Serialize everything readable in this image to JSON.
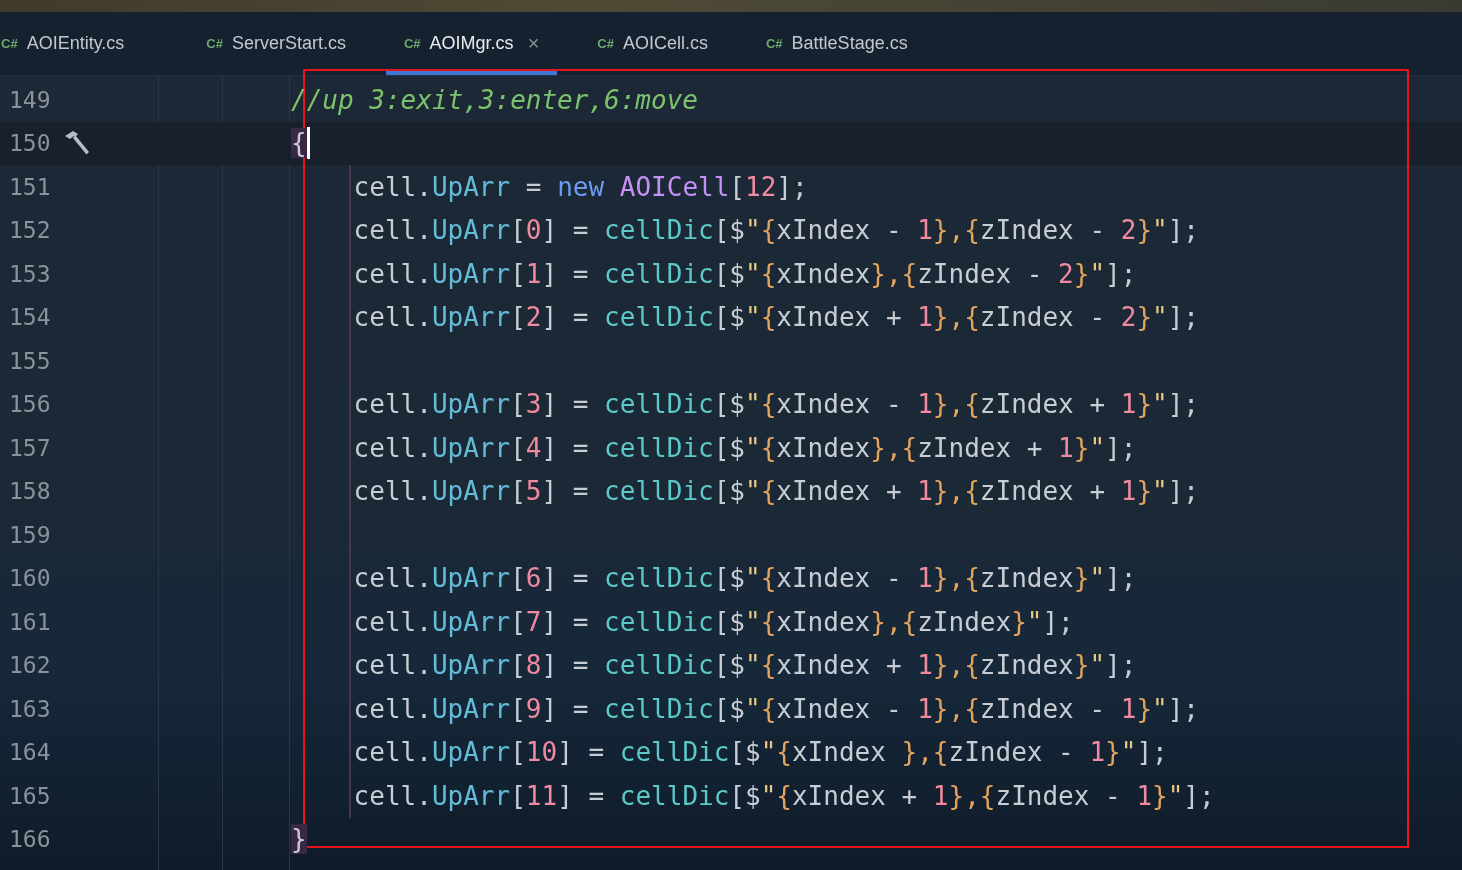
{
  "tabs": [
    {
      "icon_text": "C#",
      "label": "AOIEntity.cs",
      "selected": false
    },
    {
      "icon_text": "C#",
      "label": "ServerStart.cs",
      "selected": false
    },
    {
      "icon_text": "C#",
      "label": "AOIMgr.cs",
      "selected": true,
      "close": "×"
    },
    {
      "icon_text": "C#",
      "label": "AOICell.cs",
      "selected": false
    },
    {
      "icon_text": "C#",
      "label": "BattleStage.cs",
      "selected": false
    }
  ],
  "lines": [
    {
      "number": "149",
      "current": false,
      "build_marker": false,
      "caret": false,
      "tokens": [
        {
          "kind": "comment",
          "text": "//up 3:exit,3:enter,6:move"
        }
      ]
    },
    {
      "number": "150",
      "current": true,
      "build_marker": true,
      "caret": true,
      "tokens": [
        {
          "kind": "match",
          "text": "{"
        }
      ],
      "children": [
        {
          "number": "151",
          "current": false,
          "build_marker": false,
          "caret": false,
          "tokens": [
            {
              "kind": "plain",
              "text": "cell."
            },
            {
              "kind": "field",
              "text": "UpArr"
            },
            {
              "kind": "plain",
              "text": " = "
            },
            {
              "kind": "keyword",
              "text": "new"
            },
            {
              "kind": "type",
              "text": " AOICell"
            },
            {
              "kind": "plain",
              "text": "["
            },
            {
              "kind": "number",
              "text": "12"
            },
            {
              "kind": "plain",
              "text": "];"
            }
          ]
        },
        {
          "number": "152",
          "current": false,
          "build_marker": false,
          "caret": false,
          "tokens": [
            {
              "kind": "plain",
              "text": "cell."
            },
            {
              "kind": "field",
              "text": "UpArr"
            },
            {
              "kind": "plain",
              "text": "["
            },
            {
              "kind": "number",
              "text": "0"
            },
            {
              "kind": "plain",
              "text": "] = "
            },
            {
              "kind": "method",
              "text": "cellDic"
            },
            {
              "kind": "plain",
              "text": "[$"
            },
            {
              "kind": "string",
              "text": "\""
            },
            {
              "kind": "brace",
              "text": "{"
            },
            {
              "kind": "plain",
              "text": "xIndex - "
            },
            {
              "kind": "number",
              "text": "1"
            },
            {
              "kind": "brace",
              "text": "},{"
            },
            {
              "kind": "plain",
              "text": "zIndex - "
            },
            {
              "kind": "number",
              "text": "2"
            },
            {
              "kind": "brace",
              "text": "}"
            },
            {
              "kind": "string",
              "text": "\""
            },
            {
              "kind": "plain",
              "text": "];"
            }
          ]
        },
        {
          "number": "153",
          "current": false,
          "build_marker": false,
          "caret": false,
          "tokens": [
            {
              "kind": "plain",
              "text": "cell."
            },
            {
              "kind": "field",
              "text": "UpArr"
            },
            {
              "kind": "plain",
              "text": "["
            },
            {
              "kind": "number",
              "text": "1"
            },
            {
              "kind": "plain",
              "text": "] = "
            },
            {
              "kind": "method",
              "text": "cellDic"
            },
            {
              "kind": "plain",
              "text": "[$"
            },
            {
              "kind": "string",
              "text": "\""
            },
            {
              "kind": "brace",
              "text": "{"
            },
            {
              "kind": "plain",
              "text": "xIndex"
            },
            {
              "kind": "brace",
              "text": "},{"
            },
            {
              "kind": "plain",
              "text": "zIndex - "
            },
            {
              "kind": "number",
              "text": "2"
            },
            {
              "kind": "brace",
              "text": "}"
            },
            {
              "kind": "string",
              "text": "\""
            },
            {
              "kind": "plain",
              "text": "];"
            }
          ]
        },
        {
          "number": "154",
          "current": false,
          "build_marker": false,
          "caret": false,
          "tokens": [
            {
              "kind": "plain",
              "text": "cell."
            },
            {
              "kind": "field",
              "text": "UpArr"
            },
            {
              "kind": "plain",
              "text": "["
            },
            {
              "kind": "number",
              "text": "2"
            },
            {
              "kind": "plain",
              "text": "] = "
            },
            {
              "kind": "method",
              "text": "cellDic"
            },
            {
              "kind": "plain",
              "text": "[$"
            },
            {
              "kind": "string",
              "text": "\""
            },
            {
              "kind": "brace",
              "text": "{"
            },
            {
              "kind": "plain",
              "text": "xIndex + "
            },
            {
              "kind": "number",
              "text": "1"
            },
            {
              "kind": "brace",
              "text": "},{"
            },
            {
              "kind": "plain",
              "text": "zIndex - "
            },
            {
              "kind": "number",
              "text": "2"
            },
            {
              "kind": "brace",
              "text": "}"
            },
            {
              "kind": "string",
              "text": "\""
            },
            {
              "kind": "plain",
              "text": "];"
            }
          ]
        },
        {
          "number": "155",
          "current": false,
          "build_marker": false,
          "caret": false
        },
        {
          "number": "156",
          "current": false,
          "build_marker": false,
          "caret": false,
          "tokens": [
            {
              "kind": "plain",
              "text": "cell."
            },
            {
              "kind": "field",
              "text": "UpArr"
            },
            {
              "kind": "plain",
              "text": "["
            },
            {
              "kind": "number",
              "text": "3"
            },
            {
              "kind": "plain",
              "text": "] = "
            },
            {
              "kind": "method",
              "text": "cellDic"
            },
            {
              "kind": "plain",
              "text": "[$"
            },
            {
              "kind": "string",
              "text": "\""
            },
            {
              "kind": "brace",
              "text": "{"
            },
            {
              "kind": "plain",
              "text": "xIndex - "
            },
            {
              "kind": "number",
              "text": "1"
            },
            {
              "kind": "brace",
              "text": "},{"
            },
            {
              "kind": "plain",
              "text": "zIndex + "
            },
            {
              "kind": "number",
              "text": "1"
            },
            {
              "kind": "brace",
              "text": "}"
            },
            {
              "kind": "string",
              "text": "\""
            },
            {
              "kind": "plain",
              "text": "];"
            }
          ]
        },
        {
          "number": "157",
          "current": false,
          "build_marker": false,
          "caret": false,
          "tokens": [
            {
              "kind": "plain",
              "text": "cell."
            },
            {
              "kind": "field",
              "text": "UpArr"
            },
            {
              "kind": "plain",
              "text": "["
            },
            {
              "kind": "number",
              "text": "4"
            },
            {
              "kind": "plain",
              "text": "] = "
            },
            {
              "kind": "method",
              "text": "cellDic"
            },
            {
              "kind": "plain",
              "text": "[$"
            },
            {
              "kind": "string",
              "text": "\""
            },
            {
              "kind": "brace",
              "text": "{"
            },
            {
              "kind": "plain",
              "text": "xIndex"
            },
            {
              "kind": "brace",
              "text": "},{"
            },
            {
              "kind": "plain",
              "text": "zIndex + "
            },
            {
              "kind": "number",
              "text": "1"
            },
            {
              "kind": "brace",
              "text": "}"
            },
            {
              "kind": "string",
              "text": "\""
            },
            {
              "kind": "plain",
              "text": "];"
            }
          ]
        },
        {
          "number": "158",
          "current": false,
          "build_marker": false,
          "caret": false,
          "tokens": [
            {
              "kind": "plain",
              "text": "cell."
            },
            {
              "kind": "field",
              "text": "UpArr"
            },
            {
              "kind": "plain",
              "text": "["
            },
            {
              "kind": "number",
              "text": "5"
            },
            {
              "kind": "plain",
              "text": "] = "
            },
            {
              "kind": "method",
              "text": "cellDic"
            },
            {
              "kind": "plain",
              "text": "[$"
            },
            {
              "kind": "string",
              "text": "\""
            },
            {
              "kind": "brace",
              "text": "{"
            },
            {
              "kind": "plain",
              "text": "xIndex + "
            },
            {
              "kind": "number",
              "text": "1"
            },
            {
              "kind": "brace",
              "text": "},{"
            },
            {
              "kind": "plain",
              "text": "zIndex + "
            },
            {
              "kind": "number",
              "text": "1"
            },
            {
              "kind": "brace",
              "text": "}"
            },
            {
              "kind": "string",
              "text": "\""
            },
            {
              "kind": "plain",
              "text": "];"
            }
          ]
        },
        {
          "number": "159",
          "current": false,
          "build_marker": false,
          "caret": false
        },
        {
          "number": "160",
          "current": false,
          "build_marker": false,
          "caret": false,
          "tokens": [
            {
              "kind": "plain",
              "text": "cell."
            },
            {
              "kind": "field",
              "text": "UpArr"
            },
            {
              "kind": "plain",
              "text": "["
            },
            {
              "kind": "number",
              "text": "6"
            },
            {
              "kind": "plain",
              "text": "] = "
            },
            {
              "kind": "method",
              "text": "cellDic"
            },
            {
              "kind": "plain",
              "text": "[$"
            },
            {
              "kind": "string",
              "text": "\""
            },
            {
              "kind": "brace",
              "text": "{"
            },
            {
              "kind": "plain",
              "text": "xIndex - "
            },
            {
              "kind": "number",
              "text": "1"
            },
            {
              "kind": "brace",
              "text": "},{"
            },
            {
              "kind": "plain",
              "text": "zIndex"
            },
            {
              "kind": "brace",
              "text": "}"
            },
            {
              "kind": "string",
              "text": "\""
            },
            {
              "kind": "plain",
              "text": "];"
            }
          ]
        },
        {
          "number": "161",
          "current": false,
          "build_marker": false,
          "caret": false,
          "tokens": [
            {
              "kind": "plain",
              "text": "cell."
            },
            {
              "kind": "field",
              "text": "UpArr"
            },
            {
              "kind": "plain",
              "text": "["
            },
            {
              "kind": "number",
              "text": "7"
            },
            {
              "kind": "plain",
              "text": "] = "
            },
            {
              "kind": "method",
              "text": "cellDic"
            },
            {
              "kind": "plain",
              "text": "[$"
            },
            {
              "kind": "string",
              "text": "\""
            },
            {
              "kind": "brace",
              "text": "{"
            },
            {
              "kind": "plain",
              "text": "xIndex"
            },
            {
              "kind": "brace",
              "text": "},{"
            },
            {
              "kind": "plain",
              "text": "zIndex"
            },
            {
              "kind": "brace",
              "text": "}"
            },
            {
              "kind": "string",
              "text": "\""
            },
            {
              "kind": "plain",
              "text": "];"
            }
          ]
        },
        {
          "number": "162",
          "current": false,
          "build_marker": false,
          "caret": false,
          "tokens": [
            {
              "kind": "plain",
              "text": "cell."
            },
            {
              "kind": "field",
              "text": "UpArr"
            },
            {
              "kind": "plain",
              "text": "["
            },
            {
              "kind": "number",
              "text": "8"
            },
            {
              "kind": "plain",
              "text": "] = "
            },
            {
              "kind": "method",
              "text": "cellDic"
            },
            {
              "kind": "plain",
              "text": "[$"
            },
            {
              "kind": "string",
              "text": "\""
            },
            {
              "kind": "brace",
              "text": "{"
            },
            {
              "kind": "plain",
              "text": "xIndex + "
            },
            {
              "kind": "number",
              "text": "1"
            },
            {
              "kind": "brace",
              "text": "},{"
            },
            {
              "kind": "plain",
              "text": "zIndex"
            },
            {
              "kind": "brace",
              "text": "}"
            },
            {
              "kind": "string",
              "text": "\""
            },
            {
              "kind": "plain",
              "text": "];"
            }
          ]
        },
        {
          "number": "163",
          "current": false,
          "build_marker": false,
          "caret": false,
          "tokens": [
            {
              "kind": "plain",
              "text": "cell."
            },
            {
              "kind": "field",
              "text": "UpArr"
            },
            {
              "kind": "plain",
              "text": "["
            },
            {
              "kind": "number",
              "text": "9"
            },
            {
              "kind": "plain",
              "text": "] = "
            },
            {
              "kind": "method",
              "text": "cellDic"
            },
            {
              "kind": "plain",
              "text": "[$"
            },
            {
              "kind": "string",
              "text": "\""
            },
            {
              "kind": "brace",
              "text": "{"
            },
            {
              "kind": "plain",
              "text": "xIndex - "
            },
            {
              "kind": "number",
              "text": "1"
            },
            {
              "kind": "brace",
              "text": "},{"
            },
            {
              "kind": "plain",
              "text": "zIndex - "
            },
            {
              "kind": "number",
              "text": "1"
            },
            {
              "kind": "brace",
              "text": "}"
            },
            {
              "kind": "string",
              "text": "\""
            },
            {
              "kind": "plain",
              "text": "];"
            }
          ]
        },
        {
          "number": "164",
          "current": false,
          "build_marker": false,
          "caret": false,
          "tokens": [
            {
              "kind": "plain",
              "text": "cell."
            },
            {
              "kind": "field",
              "text": "UpArr"
            },
            {
              "kind": "plain",
              "text": "["
            },
            {
              "kind": "number",
              "text": "10"
            },
            {
              "kind": "plain",
              "text": "] = "
            },
            {
              "kind": "method",
              "text": "cellDic"
            },
            {
              "kind": "plain",
              "text": "[$"
            },
            {
              "kind": "string",
              "text": "\""
            },
            {
              "kind": "brace",
              "text": "{"
            },
            {
              "kind": "plain",
              "text": "xIndex "
            },
            {
              "kind": "brace",
              "text": "},{"
            },
            {
              "kind": "plain",
              "text": "zIndex - "
            },
            {
              "kind": "number",
              "text": "1"
            },
            {
              "kind": "brace",
              "text": "}"
            },
            {
              "kind": "string",
              "text": "\""
            },
            {
              "kind": "plain",
              "text": "];"
            }
          ]
        },
        {
          "number": "165",
          "current": false,
          "build_marker": false,
          "caret": false,
          "tokens": [
            {
              "kind": "plain",
              "text": "cell."
            },
            {
              "kind": "field",
              "text": "UpArr"
            },
            {
              "kind": "plain",
              "text": "["
            },
            {
              "kind": "number",
              "text": "11"
            },
            {
              "kind": "plain",
              "text": "] = "
            },
            {
              "kind": "method",
              "text": "cellDic"
            },
            {
              "kind": "plain",
              "text": "[$"
            },
            {
              "kind": "string",
              "text": "\""
            },
            {
              "kind": "brace",
              "text": "{"
            },
            {
              "kind": "plain",
              "text": "xIndex + "
            },
            {
              "kind": "number",
              "text": "1"
            },
            {
              "kind": "brace",
              "text": "},{"
            },
            {
              "kind": "plain",
              "text": "zIndex - "
            },
            {
              "kind": "number",
              "text": "1"
            },
            {
              "kind": "brace",
              "text": "}"
            },
            {
              "kind": "string",
              "text": "\""
            },
            {
              "kind": "plain",
              "text": "];"
            }
          ]
        }
      ]
    },
    {
      "number": "166",
      "current": false,
      "build_marker": false,
      "caret": false,
      "tokens": [
        {
          "kind": "match",
          "text": "}"
        }
      ]
    }
  ]
}
